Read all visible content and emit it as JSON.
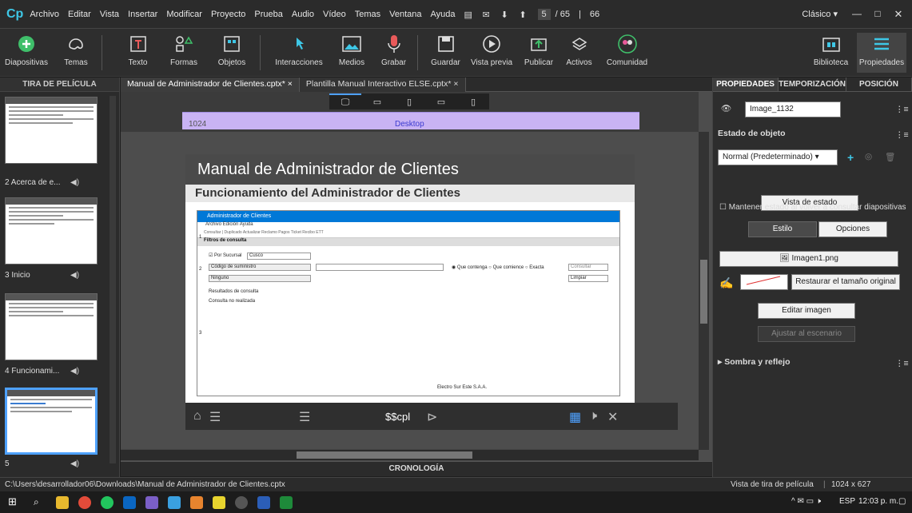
{
  "menubar": {
    "logo": "Cp",
    "items": [
      "Archivo",
      "Editar",
      "Vista",
      "Insertar",
      "Modificar",
      "Proyecto",
      "Prueba",
      "Audio",
      "Vídeo",
      "Temas",
      "Ventana",
      "Ayuda"
    ],
    "current_page": "5",
    "total_pages": "/ 65",
    "page_sep": "|",
    "zoom": "66",
    "workspace": "Clásico"
  },
  "toolbar": {
    "tools": [
      {
        "label": "Diapositivas",
        "icon": "plus-icon"
      },
      {
        "label": "Temas",
        "icon": "themes-icon"
      },
      {
        "label": "Texto",
        "icon": "text-icon"
      },
      {
        "label": "Formas",
        "icon": "shapes-icon"
      },
      {
        "label": "Objetos",
        "icon": "objects-icon"
      },
      {
        "label": "Interacciones",
        "icon": "pointer-icon"
      },
      {
        "label": "Medios",
        "icon": "image-icon"
      },
      {
        "label": "Grabar",
        "icon": "microphone-icon"
      },
      {
        "label": "Guardar",
        "icon": "save-icon"
      },
      {
        "label": "Vista previa",
        "icon": "play-icon"
      },
      {
        "label": "Publicar",
        "icon": "publish-icon"
      },
      {
        "label": "Activos",
        "icon": "assets-icon"
      },
      {
        "label": "Comunidad",
        "icon": "community-icon"
      },
      {
        "label": "Biblioteca",
        "icon": "library-icon"
      },
      {
        "label": "Propiedades",
        "icon": "properties-icon"
      }
    ]
  },
  "filmstrip": {
    "title": "TIRA DE PELÍCULA",
    "slides": [
      {
        "label": "2 Acerca de e..."
      },
      {
        "label": "3 Inicio"
      },
      {
        "label": "4 Funcionami..."
      },
      {
        "label": "5"
      }
    ]
  },
  "tabs": [
    {
      "label": "Manual de Administrador de Clientes.cptx*",
      "close": "×"
    },
    {
      "label": "Plantilla Manual Interactivo ELSE.cptx*",
      "close": "×"
    }
  ],
  "ruler": {
    "left_value": "1024",
    "center_label": "Desktop"
  },
  "slide": {
    "title": "Manual de Administrador de Clientes",
    "subtitle": "Funcionamiento del Administrador de Clientes",
    "shot": {
      "window_title": "Administrador de Clientes",
      "menu": "Archivo   Edición   Ayuda",
      "toolbar_text": "Consultar | Duplicado  Actualizar  Reclamo  Pagos  Ticket Recibo  ETT",
      "section": "Filtros de consulta",
      "check_label": "Por Sucursal",
      "select1": "Cusco",
      "field_label": "Código de suministro",
      "radio1": "Que contenga",
      "radio2": "Que comience",
      "radio3": "Exacta",
      "btn_consult": "Consultar",
      "select2": "Ninguno",
      "btn_clear": "Limpiar",
      "results_label": "Resultados de consulta",
      "results_text": "Consulta no realizada",
      "footer": "Electro Sur Este S.A.A.",
      "markers": [
        "1",
        "2",
        "3"
      ]
    },
    "playbar_var": "$$cpl"
  },
  "timeline": "CRONOLOGÍA",
  "properties": {
    "tabs": [
      "PROPIEDADES",
      "TEMPORIZACIÓN",
      "POSICIÓN"
    ],
    "name": "Image_1132",
    "state_title": "Estado de objeto",
    "state_value": "Normal (Predeterminado)",
    "state_view_btn": "Vista de estado",
    "keep_state": "Mantener estado al volver a consultar diapositivas",
    "subtabs": [
      "Estilo",
      "Opciones"
    ],
    "image_file": "Imagen1.png",
    "restore_btn": "Restaurar el tamaño original",
    "edit_btn": "Editar imagen",
    "fit_btn": "Ajustar al escenario",
    "shadow": "Sombra y reflejo"
  },
  "status": {
    "path": "C:\\Users\\desarrollador06\\Downloads\\Manual de Administrador de Clientes.cptx",
    "view": "Vista de tira de película",
    "size": "1024 x 627"
  },
  "taskbar": {
    "lang": "ESP",
    "time": "12:03 p. m."
  },
  "colors": {
    "accent": "#3ec7e6",
    "ruler": "#c9b3f4",
    "selected_thumb": "#4ea1ff"
  }
}
